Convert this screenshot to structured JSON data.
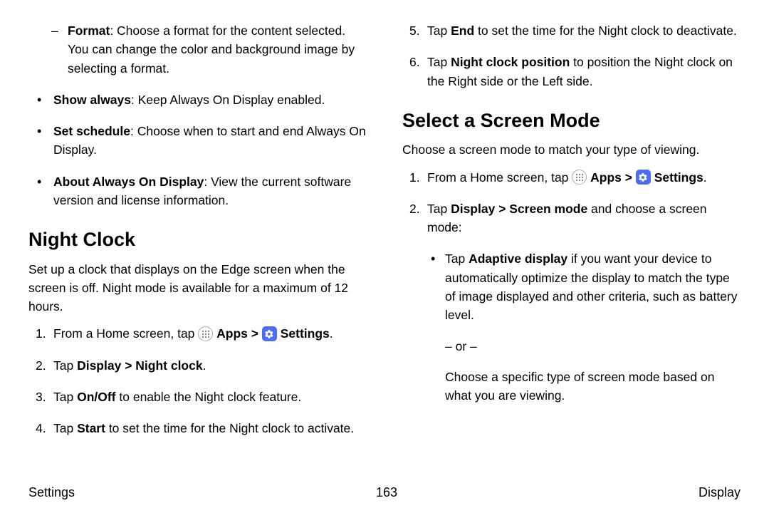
{
  "left": {
    "sub_format": {
      "bold": "Format",
      "rest": ": Choose a format for the content selected. You can change the color and background image by selecting a format."
    },
    "show_always": {
      "bold": "Show always",
      "rest": ": Keep Always On Display enabled."
    },
    "set_schedule": {
      "bold": "Set schedule",
      "rest": ": Choose when to start and end Always On Display."
    },
    "about_aod": {
      "bold": "About Always On Display",
      "rest": ": View the current software version and license information."
    },
    "h_night": "Night Clock",
    "night_intro": "Set up a clock that displays on the Edge screen when the screen is off. Night mode is available for a maximum of 12 hours.",
    "s1": {
      "n": "1.",
      "pre": "From a Home screen, tap ",
      "apps": "Apps",
      "sep": " > ",
      "settings": "Settings",
      "end": "."
    },
    "s2": {
      "n": "2.",
      "pre": "Tap ",
      "bold": "Display > Night clock",
      "end": "."
    },
    "s3": {
      "n": "3.",
      "pre": "Tap ",
      "bold": "On/Off",
      "rest": " to enable the Night clock feature."
    },
    "s4": {
      "n": "4.",
      "pre": "Tap ",
      "bold": "Start",
      "rest": " to set the time for the Night clock to activate."
    }
  },
  "right": {
    "s5": {
      "n": "5.",
      "pre": "Tap ",
      "bold": "End",
      "rest": " to set the time for the Night clock to deactivate."
    },
    "s6": {
      "n": "6.",
      "pre": "Tap ",
      "bold": "Night clock position",
      "rest": " to position the Night clock on the Right side or the Left side."
    },
    "h_screen": "Select a Screen Mode",
    "screen_intro": "Choose a screen mode to match your type of viewing.",
    "m1": {
      "n": "1.",
      "pre": "From a Home screen, tap ",
      "apps": "Apps",
      "sep": " > ",
      "settings": "Settings",
      "end": "."
    },
    "m2": {
      "n": "2.",
      "pre": "Tap ",
      "bold": "Display > Screen mode",
      "rest": " and choose a screen mode:"
    },
    "adaptive": {
      "pre": "Tap ",
      "bold": "Adaptive display",
      "rest": " if you want your device to automatically optimize the display to match the type of image displayed and other criteria, such as battery level."
    },
    "or": "– or –",
    "choose": "Choose a specific type of screen mode based on what you are viewing."
  },
  "footer": {
    "left": "Settings",
    "center": "163",
    "right": "Display"
  }
}
